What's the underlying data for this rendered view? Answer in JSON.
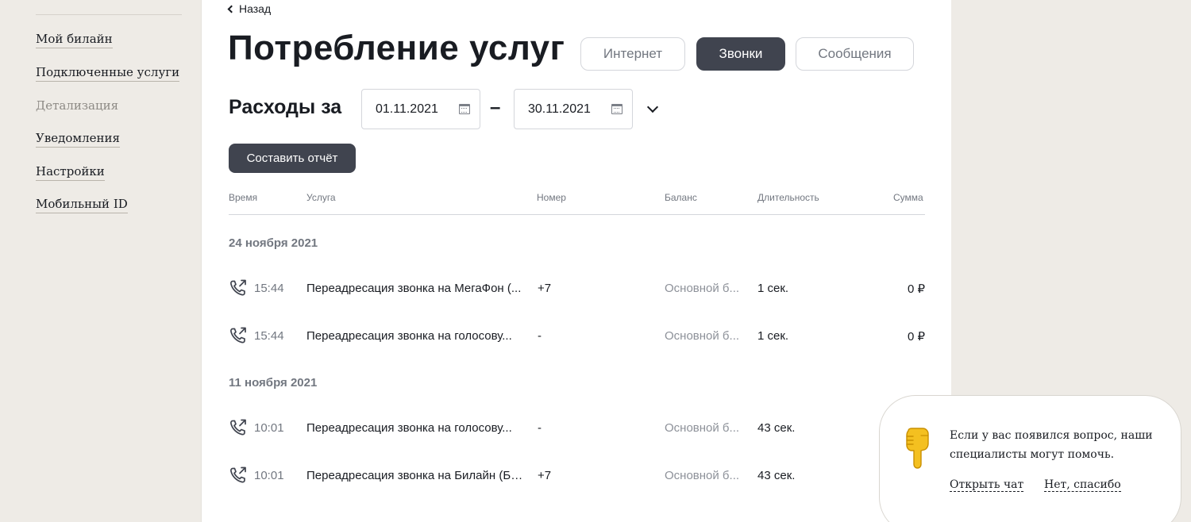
{
  "sidebar": {
    "items": [
      {
        "label": "Мой билайн",
        "active": false
      },
      {
        "label": "Подключенные услуги",
        "active": false
      },
      {
        "label": "Детализация",
        "active": true
      },
      {
        "label": "Уведомления",
        "active": false
      },
      {
        "label": "Настройки",
        "active": false
      },
      {
        "label": "Мобильный ID",
        "active": false
      }
    ]
  },
  "header": {
    "back_label": "Назад",
    "title": "Потребление услуг",
    "tabs": [
      {
        "label": "Интернет",
        "active": false
      },
      {
        "label": "Звонки",
        "active": true
      },
      {
        "label": "Сообщения",
        "active": false
      }
    ]
  },
  "filter": {
    "label": "Расходы за",
    "date_from": "01.11.2021",
    "date_to": "30.11.2021",
    "separator": "–",
    "report_button": "Составить отчёт"
  },
  "table": {
    "columns": [
      "Время",
      "Услуга",
      "Номер",
      "Баланс",
      "Длительность",
      "Сумма"
    ],
    "groups": [
      {
        "date": "24 ноября 2021",
        "rows": [
          {
            "icon": "call-forward-icon",
            "time": "15:44",
            "service": "Переадресация звонка на МегаФон (...",
            "number": "+7",
            "balance": "Основной б...",
            "duration": "1 сек.",
            "amount": "0 ₽"
          },
          {
            "icon": "call-forward-icon",
            "time": "15:44",
            "service": "Переадресация звонка на голосову...",
            "number": "-",
            "balance": "Основной б...",
            "duration": "1 сек.",
            "amount": "0 ₽"
          }
        ]
      },
      {
        "date": "11 ноября 2021",
        "rows": [
          {
            "icon": "call-forward-icon",
            "time": "10:01",
            "service": "Переадресация звонка на голосову...",
            "number": "-",
            "balance": "Основной б...",
            "duration": "43 сек.",
            "amount": ""
          },
          {
            "icon": "call-forward-icon",
            "time": "10:01",
            "service": "Переадресация звонка на Билайн (Ба...",
            "number": "+7",
            "balance": "Основной б...",
            "duration": "43 сек.",
            "amount": ""
          }
        ]
      }
    ]
  },
  "chat": {
    "icon": "pointing-hand-icon",
    "message": "Если у вас появился вопрос, наши специалисты могут помочь.",
    "open_label": "Открыть чат",
    "dismiss_label": "Нет, спасибо"
  },
  "colors": {
    "page_bg": "#eeebe6",
    "accent_dark": "#40444f",
    "muted_text": "#727780"
  }
}
